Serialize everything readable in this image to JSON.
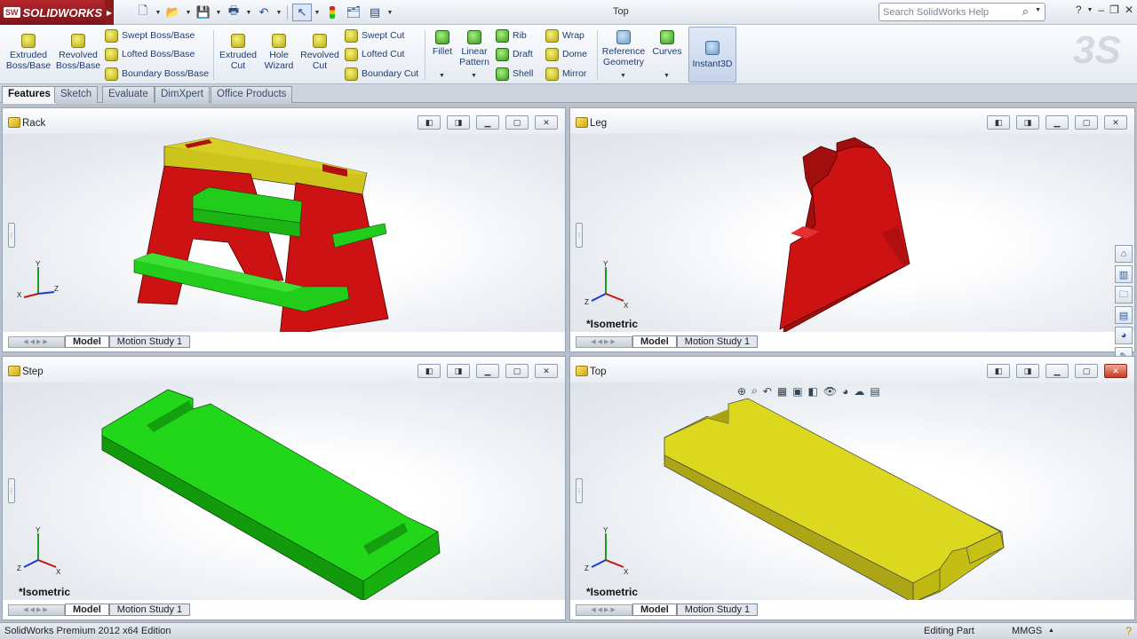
{
  "app": {
    "name": "SOLIDWORKS",
    "logo_mark": "SW",
    "window_title": "Top"
  },
  "search": {
    "placeholder": "Search SolidWorks Help"
  },
  "ribbon": {
    "extruded_boss": "Extruded Boss/Base",
    "revolved_boss": "Revolved Boss/Base",
    "swept_boss": "Swept Boss/Base",
    "lofted_boss": "Lofted Boss/Base",
    "boundary_boss": "Boundary Boss/Base",
    "extruded_cut": "Extruded Cut",
    "hole_wizard": "Hole Wizard",
    "revolved_cut": "Revolved Cut",
    "swept_cut": "Swept Cut",
    "lofted_cut": "Lofted Cut",
    "boundary_cut": "Boundary Cut",
    "fillet": "Fillet",
    "linear_pattern": "Linear Pattern",
    "rib": "Rib",
    "draft": "Draft",
    "shell": "Shell",
    "wrap": "Wrap",
    "dome": "Dome",
    "mirror": "Mirror",
    "reference_geometry": "Reference Geometry",
    "curves": "Curves",
    "instant3d": "Instant3D"
  },
  "tabs": [
    "Features",
    "Sketch",
    "Evaluate",
    "DimXpert",
    "Office Products"
  ],
  "active_tab": "Features",
  "panes": {
    "rack": {
      "title": "Rack",
      "view_label": ""
    },
    "leg": {
      "title": "Leg",
      "view_label": "*Isometric"
    },
    "step": {
      "title": "Step",
      "view_label": "*Isometric"
    },
    "top": {
      "title": "Top",
      "view_label": "*Isometric"
    }
  },
  "footer_tabs": {
    "model": "Model",
    "motion": "Motion Study 1"
  },
  "status": {
    "edition": "SolidWorks Premium 2012 x64 Edition",
    "mode": "Editing Part",
    "units": "MMGS"
  },
  "colors": {
    "rack_body": "#cc1212",
    "rack_top": "#c8c21a",
    "step": "#22d61a",
    "top_part": "#dcd81f"
  }
}
